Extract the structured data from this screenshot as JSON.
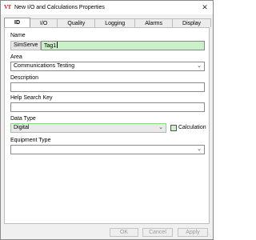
{
  "window": {
    "app_icon": "VT",
    "title": "New I/O and Calculations Properties",
    "close_glyph": "✕"
  },
  "tabs": [
    {
      "label": "ID"
    },
    {
      "label": "I/O"
    },
    {
      "label": "Quality"
    },
    {
      "label": "Logging"
    },
    {
      "label": "Alarms"
    },
    {
      "label": "Display"
    }
  ],
  "form": {
    "name": {
      "label": "Name",
      "prefix": "SimServe",
      "value": "Tag1"
    },
    "area": {
      "label": "Area",
      "value": "Communications Testing"
    },
    "description": {
      "label": "Description",
      "value": ""
    },
    "help_search_key": {
      "label": "Help Search Key",
      "value": ""
    },
    "data_type": {
      "label": "Data Type",
      "value": "Digital"
    },
    "calculation": {
      "label": "Calculation",
      "checked": false
    },
    "equipment_type": {
      "label": "Equipment Type",
      "value": ""
    }
  },
  "buttons": {
    "ok": "OK",
    "cancel": "Cancel",
    "apply": "Apply"
  },
  "icons": {
    "chevron": "chevron-down-icon",
    "close": "close-icon",
    "grip": "resize-grip-icon"
  },
  "colors": {
    "highlight_green": "#c9f0c9",
    "brand_red": "#c0202a"
  }
}
